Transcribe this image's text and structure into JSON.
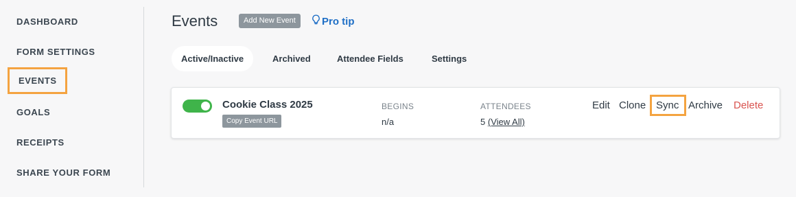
{
  "sidebar": {
    "items": [
      {
        "label": "DASHBOARD"
      },
      {
        "label": "FORM SETTINGS"
      },
      {
        "label": "EVENTS"
      },
      {
        "label": "GOALS"
      },
      {
        "label": "RECEIPTS"
      },
      {
        "label": "SHARE YOUR FORM"
      }
    ]
  },
  "header": {
    "title": "Events",
    "add_button": "Add New Event",
    "pro_tip": "Pro tip",
    "pro_tip_icon": "lightbulb-icon"
  },
  "tabs": [
    {
      "label": "Active/Inactive",
      "active": true
    },
    {
      "label": "Archived"
    },
    {
      "label": "Attendee Fields"
    },
    {
      "label": "Settings"
    }
  ],
  "event": {
    "enabled": true,
    "name": "Cookie Class 2025",
    "copy_url_label": "Copy Event URL",
    "begins_label": "BEGINS",
    "begins_value": "n/a",
    "attendees_label": "ATTENDEES",
    "attendees_count": "5",
    "view_all": "(View All)",
    "actions": {
      "edit": "Edit",
      "clone": "Clone",
      "sync": "Sync",
      "archive": "Archive",
      "delete": "Delete"
    }
  },
  "colors": {
    "highlight": "#f4a340",
    "toggle_on": "#3fb44a",
    "link": "#1f6fc6",
    "danger": "#d9534f"
  }
}
